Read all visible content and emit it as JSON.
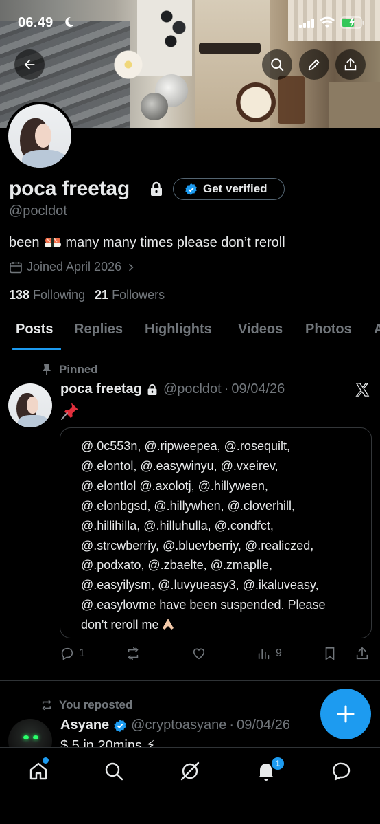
{
  "status_bar": {
    "time": "06.49"
  },
  "profile": {
    "display_name": "poca freetag",
    "get_verified_label": "Get verified",
    "handle": "@pocldot",
    "bio_before": "been",
    "bio_after": "many many times please don’t reroll",
    "joined": "Joined April 2026",
    "following_count": "138",
    "following_label": "Following",
    "followers_count": "21",
    "followers_label": "Followers"
  },
  "tabs": [
    {
      "label": "Posts",
      "active": true
    },
    {
      "label": "Replies"
    },
    {
      "label": "Highlights"
    },
    {
      "label": "Videos"
    },
    {
      "label": "Photos"
    },
    {
      "label": "A"
    }
  ],
  "pinned_tweet": {
    "pinned_label": "Pinned",
    "author_name": "poca freetag",
    "author_handle": "@pocldot",
    "separator": "·",
    "date": "09/04/26",
    "quote_lines": [
      "@.0c553n, @.ripweepea, @.rosequilt,",
      "@.elontol, @.easywinyu, @.vxeirev,",
      "@.elontlol @.axolotj, @.hillyween,",
      "@.elonbgsd, @.hillywhen, @.cloverhill,",
      "@.hillihilla, @.hilluhulla, @.condfct,",
      "@.strcwberriy, @.bluevberriy, @.realiczed,",
      "@.podxato, @.zbaelte, @.zmaplle,",
      "@.easyilysm, @.luvyueasy3, @.ikaluveasy,",
      "@.easylovme have been suspended. Please",
      "don't reroll me"
    ],
    "replies": "1",
    "views": "9"
  },
  "second_tweet": {
    "repost_label": "You reposted",
    "author_name": "Asyane",
    "author_handle": "@cryptoasyane",
    "separator": "·",
    "date": "09/04/26",
    "text": "$ 5 in 20mins ⚡"
  },
  "bottom_nav": {
    "notification_count": "1"
  },
  "colors": {
    "accent": "#1d9bf0",
    "muted": "#71767b",
    "text": "#e7e9ea",
    "border": "#2f3336"
  },
  "icons": [
    "back-arrow-icon",
    "search-icon",
    "pencil-icon",
    "share-icon",
    "lock-icon",
    "verified-badge-icon",
    "calendar-icon",
    "pin-icon",
    "x-logo-icon",
    "reply-icon",
    "repost-icon",
    "like-icon",
    "views-icon",
    "bookmark-icon",
    "plus-icon",
    "home-icon",
    "explore-icon",
    "grok-icon",
    "bell-icon",
    "messages-icon"
  ]
}
